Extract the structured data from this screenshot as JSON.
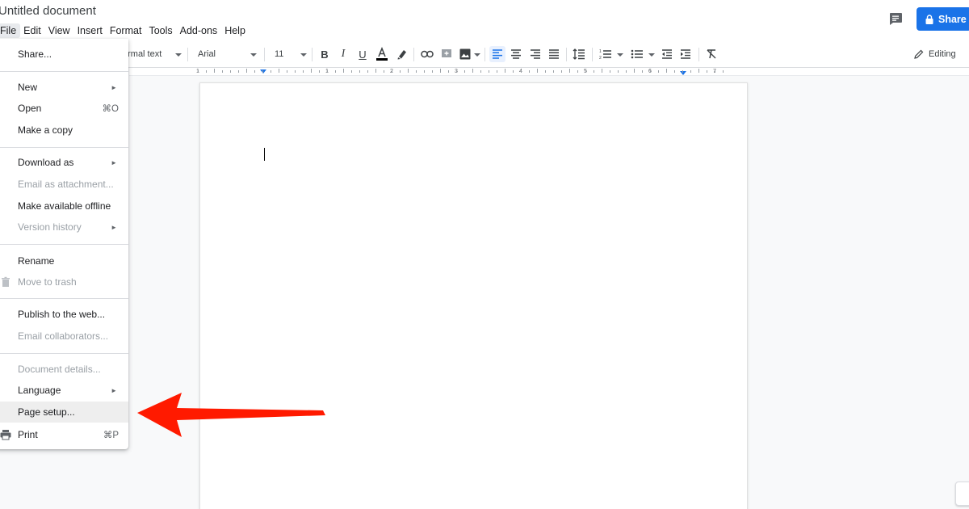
{
  "header": {
    "title": "Untitled document",
    "share_label": "Share"
  },
  "menubar": [
    "File",
    "Edit",
    "View",
    "Insert",
    "Format",
    "Tools",
    "Add-ons",
    "Help"
  ],
  "toolbar": {
    "style_value": "ormal text",
    "font_value": "Arial",
    "size_value": "11",
    "mode_label": "Editing"
  },
  "ruler": {
    "numbers": [
      "1",
      "1",
      "2",
      "3",
      "4",
      "5",
      "6",
      "7"
    ]
  },
  "file_menu": {
    "items": [
      {
        "label": "Share...",
        "shortcut": "",
        "submenu": false,
        "disabled": false
      },
      {
        "label": "New",
        "shortcut": "",
        "submenu": true,
        "disabled": false
      },
      {
        "label": "Open",
        "shortcut": "⌘O",
        "submenu": false,
        "disabled": false
      },
      {
        "label": "Make a copy",
        "shortcut": "",
        "submenu": false,
        "disabled": false
      },
      {
        "label": "Download as",
        "shortcut": "",
        "submenu": true,
        "disabled": false
      },
      {
        "label": "Email as attachment...",
        "shortcut": "",
        "submenu": false,
        "disabled": true
      },
      {
        "label": "Make available offline",
        "shortcut": "",
        "submenu": false,
        "disabled": false
      },
      {
        "label": "Version history",
        "shortcut": "",
        "submenu": true,
        "disabled": true
      },
      {
        "label": "Rename",
        "shortcut": "",
        "submenu": false,
        "disabled": false
      },
      {
        "label": "Move to trash",
        "shortcut": "",
        "submenu": false,
        "disabled": true
      },
      {
        "label": "Publish to the web...",
        "shortcut": "",
        "submenu": false,
        "disabled": false
      },
      {
        "label": "Email collaborators...",
        "shortcut": "",
        "submenu": false,
        "disabled": true
      },
      {
        "label": "Document details...",
        "shortcut": "",
        "submenu": false,
        "disabled": true
      },
      {
        "label": "Language",
        "shortcut": "",
        "submenu": true,
        "disabled": false
      },
      {
        "label": "Page setup...",
        "shortcut": "",
        "submenu": false,
        "disabled": false
      },
      {
        "label": "Print",
        "shortcut": "⌘P",
        "submenu": false,
        "disabled": false
      }
    ]
  },
  "colors": {
    "share_blue": "#1a73e8",
    "annotation_red": "#ff1a00",
    "menu_highlight": "#eeeeee"
  }
}
